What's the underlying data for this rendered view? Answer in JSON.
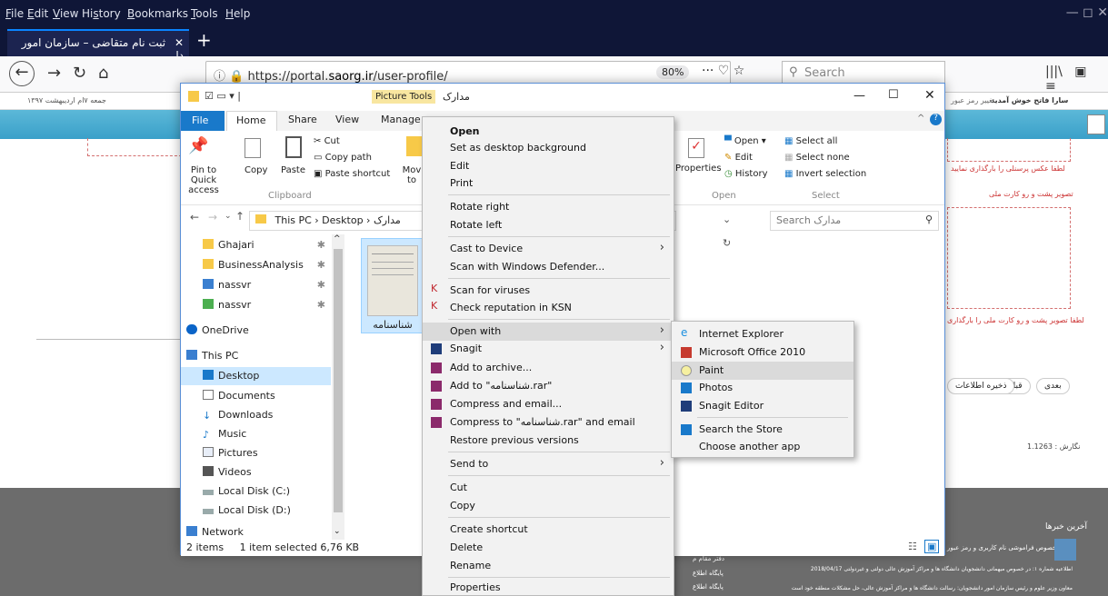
{
  "browser": {
    "menu": [
      "File",
      "Edit",
      "View",
      "History",
      "Bookmarks",
      "Tools",
      "Help"
    ],
    "tab_title": "ثبت نام متقاضی – سازمان امور دا",
    "tab_close": "✕",
    "new_tab": "+",
    "url_prefix": "https://portal.",
    "url_host": "saorg.ir",
    "url_path": "/user-profile/",
    "zoom": "80%",
    "page_actions": "··· ♡ ☆",
    "search_placeholder": "Search",
    "window_controls": "—   ◻   ✕"
  },
  "site": {
    "date": "جمعه ۷ام اردیبهشت ۱۳۹۷",
    "welcome": "سارا فاتح خوش آمدید",
    "change_pass": "تغییر رمز عبور",
    "upload_note1": "لطفا عکس پرسنلی را بارگذاری نمایید",
    "upload_label": "تصویر پشت و رو کارت ملی",
    "upload_note2": "لطفا تصویر پشت و رو کارت ملی را بارگذاری",
    "btn_next": "بعدی",
    "btn_prev": "قبلی",
    "btn_save": "ذخیره اطلاعات",
    "version": "نگارش : 1.1263",
    "news_title": "آخرین خبرها",
    "news1": "در خصوص فراموشی نام کاربری و رمز عبور",
    "news2": "اطلاعیه شماره ۱: در خصوص میهمانی دانشجویان دانشگاه ها و مراکز آموزش عالی دولتی و غیردولتی 2018/04/17",
    "news3": "معاون وزیر علوم و رئیس سازمان امور دانشجویان: رسالت دانشگاه ها و مراکز آموزش عالی، حل مشکلات منطقه خود است",
    "footer_a": "دفتر مقام م",
    "footer_b": "پایگاه اطلاع",
    "footer_c": "پایگاه اطلاع"
  },
  "explorer": {
    "title": "مدارک",
    "picture_tools": "Picture Tools",
    "tabs": [
      "File",
      "Home",
      "Share",
      "View",
      "Manage"
    ],
    "clipboard": {
      "pin": "Pin to Quick access",
      "copy": "Copy",
      "paste": "Paste",
      "cut": "Cut",
      "copy_path": "Copy path",
      "paste_shortcut": "Paste shortcut",
      "group": "Clipboard",
      "move": "Mov to"
    },
    "open_group": {
      "properties": "Properties",
      "open": "Open ▾",
      "edit": "Edit",
      "history": "History",
      "group": "Open"
    },
    "select_group": {
      "all": "Select all",
      "none": "Select none",
      "invert": "Invert selection",
      "group": "Select"
    },
    "breadcrumb": "This PC  ›  Desktop  ›  مدارک",
    "search_placeholder": "Search مدارک",
    "nav": [
      "Ghajari",
      "BusinessAnalysis",
      "nassvr",
      "nassvr",
      "OneDrive",
      "This PC",
      "Desktop",
      "Documents",
      "Downloads",
      "Music",
      "Pictures",
      "Videos",
      "Local Disk (C:)",
      "Local Disk (D:)",
      "Network"
    ],
    "file_name": "شناسنامه",
    "status_items": "2 items",
    "status_selected": "1 item selected  6,76 KB"
  },
  "context_menu": {
    "items": [
      "Open",
      "Set as desktop background",
      "Edit",
      "Print",
      "Rotate right",
      "Rotate left",
      "Cast to Device",
      "Scan with Windows Defender...",
      "Scan for viruses",
      "Check reputation in KSN",
      "Open with",
      "Snagit",
      "Add to archive...",
      "Add to \"شناسنامه.rar\"",
      "Compress and email...",
      "Compress to \"شناسنامه.rar\" and email",
      "Restore previous versions",
      "Send to",
      "Cut",
      "Copy",
      "Create shortcut",
      "Delete",
      "Rename",
      "Properties"
    ]
  },
  "open_with": {
    "items": [
      "Internet Explorer",
      "Microsoft Office 2010",
      "Paint",
      "Photos",
      "Snagit Editor",
      "Search the Store",
      "Choose another app"
    ]
  },
  "colors": {
    "menubar": "#0f1637",
    "accent": "#1979ca",
    "highlight": "#dadada",
    "site_strip": "#3aa0c9"
  }
}
